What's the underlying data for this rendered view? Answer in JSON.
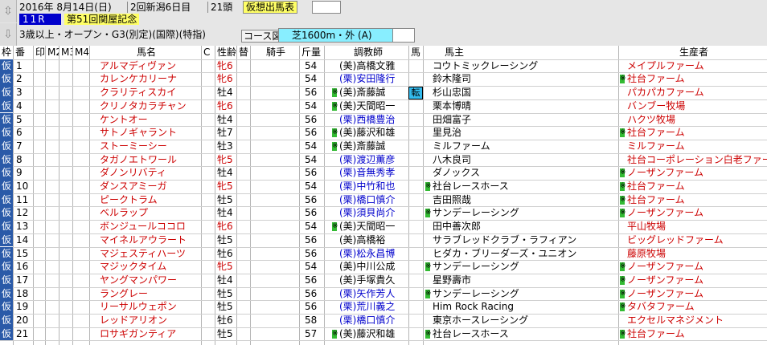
{
  "header": {
    "year_date": "2016年 8月14日(日)",
    "meeting": "2回新潟6日目",
    "runners": "21頭",
    "mode": "仮想出馬表",
    "race_number": "11R",
    "race_name": "第51回関屋記念",
    "conditions": "3歳以上・オープン・G3(別定)(国際)(特指)",
    "course_label": "コース図",
    "course": "芝1600m・外 (A)",
    "nav_up": "⇳",
    "nav_down": "⇩"
  },
  "columns": [
    "枠",
    "番",
    "印",
    "M2",
    "M3",
    "M4",
    "馬名",
    "C",
    "性齢",
    "替",
    "騎手",
    "斤量",
    "調教師",
    "馬",
    "馬主",
    "生産者"
  ],
  "colors": {
    "gray_text": "#000000",
    "horse_red": "#cc0000",
    "blue": "#0000cc",
    "header_blue": "#0000cc",
    "kari_bg": "#2a5aa8",
    "yellow": "#ffff66",
    "cyan": "#88eeff",
    "mark_green": "#33bb33"
  },
  "rows": [
    {
      "waku": "仮",
      "num": "1",
      "name": "アルマディヴァン",
      "sex": "牝6",
      "weight": "54",
      "trainer": "(美)高橋文雅",
      "trainer_blue": false,
      "mark_trainer": false,
      "owner": "コウトミックレーシング",
      "mark_owner": false,
      "breeder": "メイプルファーム",
      "mark_breeder": false
    },
    {
      "waku": "仮",
      "num": "2",
      "name": "カレンケカリーナ",
      "sex": "牝6",
      "weight": "54",
      "trainer": "(栗)安田隆行",
      "trainer_blue": true,
      "mark_trainer": false,
      "owner": "鈴木隆司",
      "mark_owner": false,
      "breeder": "社台ファーム",
      "mark_breeder": true
    },
    {
      "waku": "仮",
      "num": "3",
      "name": "クラリティスカイ",
      "sex": "牡4",
      "weight": "56",
      "trainer": "(美)斎藤誠",
      "trainer_blue": false,
      "mark_trainer": true,
      "tenkyu": "転",
      "owner": "杉山忠国",
      "mark_owner": false,
      "breeder": "パカパカファーム",
      "mark_breeder": false
    },
    {
      "waku": "仮",
      "num": "4",
      "name": "クリノタカラチャン",
      "sex": "牝6",
      "weight": "54",
      "trainer": "(美)天間昭一",
      "trainer_blue": false,
      "mark_trainer": true,
      "owner": "栗本博晴",
      "mark_owner": false,
      "breeder": "バンブー牧場",
      "mark_breeder": false
    },
    {
      "waku": "仮",
      "num": "5",
      "name": "ケントオー",
      "sex": "牡4",
      "weight": "56",
      "trainer": "(栗)西橋豊治",
      "trainer_blue": true,
      "mark_trainer": false,
      "owner": "田畑富子",
      "mark_owner": false,
      "breeder": "ハクツ牧場",
      "mark_breeder": false
    },
    {
      "waku": "仮",
      "num": "6",
      "name": "サトノギャラント",
      "sex": "牡7",
      "weight": "56",
      "trainer": "(美)藤沢和雄",
      "trainer_blue": false,
      "mark_trainer": true,
      "owner": "里見治",
      "mark_owner": false,
      "breeder": "社台ファーム",
      "mark_breeder": true
    },
    {
      "waku": "仮",
      "num": "7",
      "name": "ストーミーシー",
      "sex": "牡3",
      "weight": "54",
      "trainer": "(美)斎藤誠",
      "trainer_blue": false,
      "mark_trainer": true,
      "owner": "ミルファーム",
      "mark_owner": false,
      "breeder": "ミルファーム",
      "mark_breeder": false
    },
    {
      "waku": "仮",
      "num": "8",
      "name": "タガノエトワール",
      "sex": "牝5",
      "weight": "54",
      "trainer": "(栗)渡辺薫彦",
      "trainer_blue": true,
      "mark_trainer": false,
      "owner": "八木良司",
      "mark_owner": false,
      "breeder": "社台コーポレーション白老ファーム",
      "mark_breeder": false
    },
    {
      "waku": "仮",
      "num": "9",
      "name": "ダノンリバティ",
      "sex": "牡4",
      "weight": "56",
      "trainer": "(栗)音無秀孝",
      "trainer_blue": true,
      "mark_trainer": false,
      "owner": "ダノックス",
      "mark_owner": false,
      "breeder": "ノーザンファーム",
      "mark_breeder": true
    },
    {
      "waku": "仮",
      "num": "10",
      "name": "ダンスアミーガ",
      "sex": "牝5",
      "weight": "54",
      "trainer": "(栗)中竹和也",
      "trainer_blue": true,
      "mark_trainer": false,
      "owner": "社台レースホース",
      "mark_owner": true,
      "breeder": "社台ファーム",
      "mark_breeder": true
    },
    {
      "waku": "仮",
      "num": "11",
      "name": "ピークトラム",
      "sex": "牡5",
      "weight": "56",
      "trainer": "(栗)橋口慎介",
      "trainer_blue": true,
      "mark_trainer": false,
      "owner": "吉田照哉",
      "mark_owner": false,
      "breeder": "社台ファーム",
      "mark_breeder": true
    },
    {
      "waku": "仮",
      "num": "12",
      "name": "ベルラップ",
      "sex": "牡4",
      "weight": "56",
      "trainer": "(栗)須貝尚介",
      "trainer_blue": true,
      "mark_trainer": false,
      "owner": "サンデーレーシング",
      "mark_owner": true,
      "breeder": "ノーザンファーム",
      "mark_breeder": true
    },
    {
      "waku": "仮",
      "num": "13",
      "name": "ボンジュールココロ",
      "sex": "牝6",
      "weight": "54",
      "trainer": "(美)天間昭一",
      "trainer_blue": false,
      "mark_trainer": true,
      "owner": "田中善次郎",
      "mark_owner": false,
      "breeder": "平山牧場",
      "mark_breeder": false
    },
    {
      "waku": "仮",
      "num": "14",
      "name": "マイネルアウラート",
      "sex": "牡5",
      "weight": "56",
      "trainer": "(美)高橋裕",
      "trainer_blue": false,
      "mark_trainer": false,
      "owner": "サラブレッドクラブ・ラフィアン",
      "mark_owner": false,
      "breeder": "ビッグレッドファーム",
      "mark_breeder": false
    },
    {
      "waku": "仮",
      "num": "15",
      "name": "マジェスティハーツ",
      "sex": "牡6",
      "weight": "56",
      "trainer": "(栗)松永昌博",
      "trainer_blue": true,
      "mark_trainer": false,
      "owner": "ヒダカ・ブリーダーズ・ユニオン",
      "mark_owner": false,
      "breeder": "藤原牧場",
      "mark_breeder": false
    },
    {
      "waku": "仮",
      "num": "16",
      "name": "マジックタイム",
      "sex": "牝5",
      "weight": "54",
      "trainer": "(美)中川公成",
      "trainer_blue": false,
      "mark_trainer": false,
      "owner": "サンデーレーシング",
      "mark_owner": true,
      "breeder": "ノーザンファーム",
      "mark_breeder": true
    },
    {
      "waku": "仮",
      "num": "17",
      "name": "ヤングマンパワー",
      "sex": "牡4",
      "weight": "56",
      "trainer": "(美)手塚貴久",
      "trainer_blue": false,
      "mark_trainer": false,
      "owner": "星野壽市",
      "mark_owner": false,
      "breeder": "ノーザンファーム",
      "mark_breeder": true
    },
    {
      "waku": "仮",
      "num": "18",
      "name": "ラングレー",
      "sex": "牡5",
      "weight": "56",
      "trainer": "(栗)矢作芳人",
      "trainer_blue": true,
      "mark_trainer": false,
      "owner": "サンデーレーシング",
      "mark_owner": true,
      "breeder": "ノーザンファーム",
      "mark_breeder": true
    },
    {
      "waku": "仮",
      "num": "19",
      "name": "リーサルウェポン",
      "sex": "牡5",
      "weight": "56",
      "trainer": "(栗)荒川義之",
      "trainer_blue": true,
      "mark_trainer": false,
      "owner": "Him Rock Racing",
      "mark_owner": false,
      "breeder": "タバタファーム",
      "mark_breeder": true
    },
    {
      "waku": "仮",
      "num": "20",
      "name": "レッドアリオン",
      "sex": "牡6",
      "weight": "58",
      "trainer": "(栗)橋口慎介",
      "trainer_blue": true,
      "mark_trainer": false,
      "owner": "東京ホースレーシング",
      "mark_owner": false,
      "breeder": "エクセルマネジメント",
      "mark_breeder": false
    },
    {
      "waku": "仮",
      "num": "21",
      "name": "ロサギガンティア",
      "sex": "牡5",
      "weight": "57",
      "trainer": "(美)藤沢和雄",
      "trainer_blue": false,
      "mark_trainer": true,
      "owner": "社台レースホース",
      "mark_owner": true,
      "breeder": "社台ファーム",
      "mark_breeder": true
    }
  ]
}
